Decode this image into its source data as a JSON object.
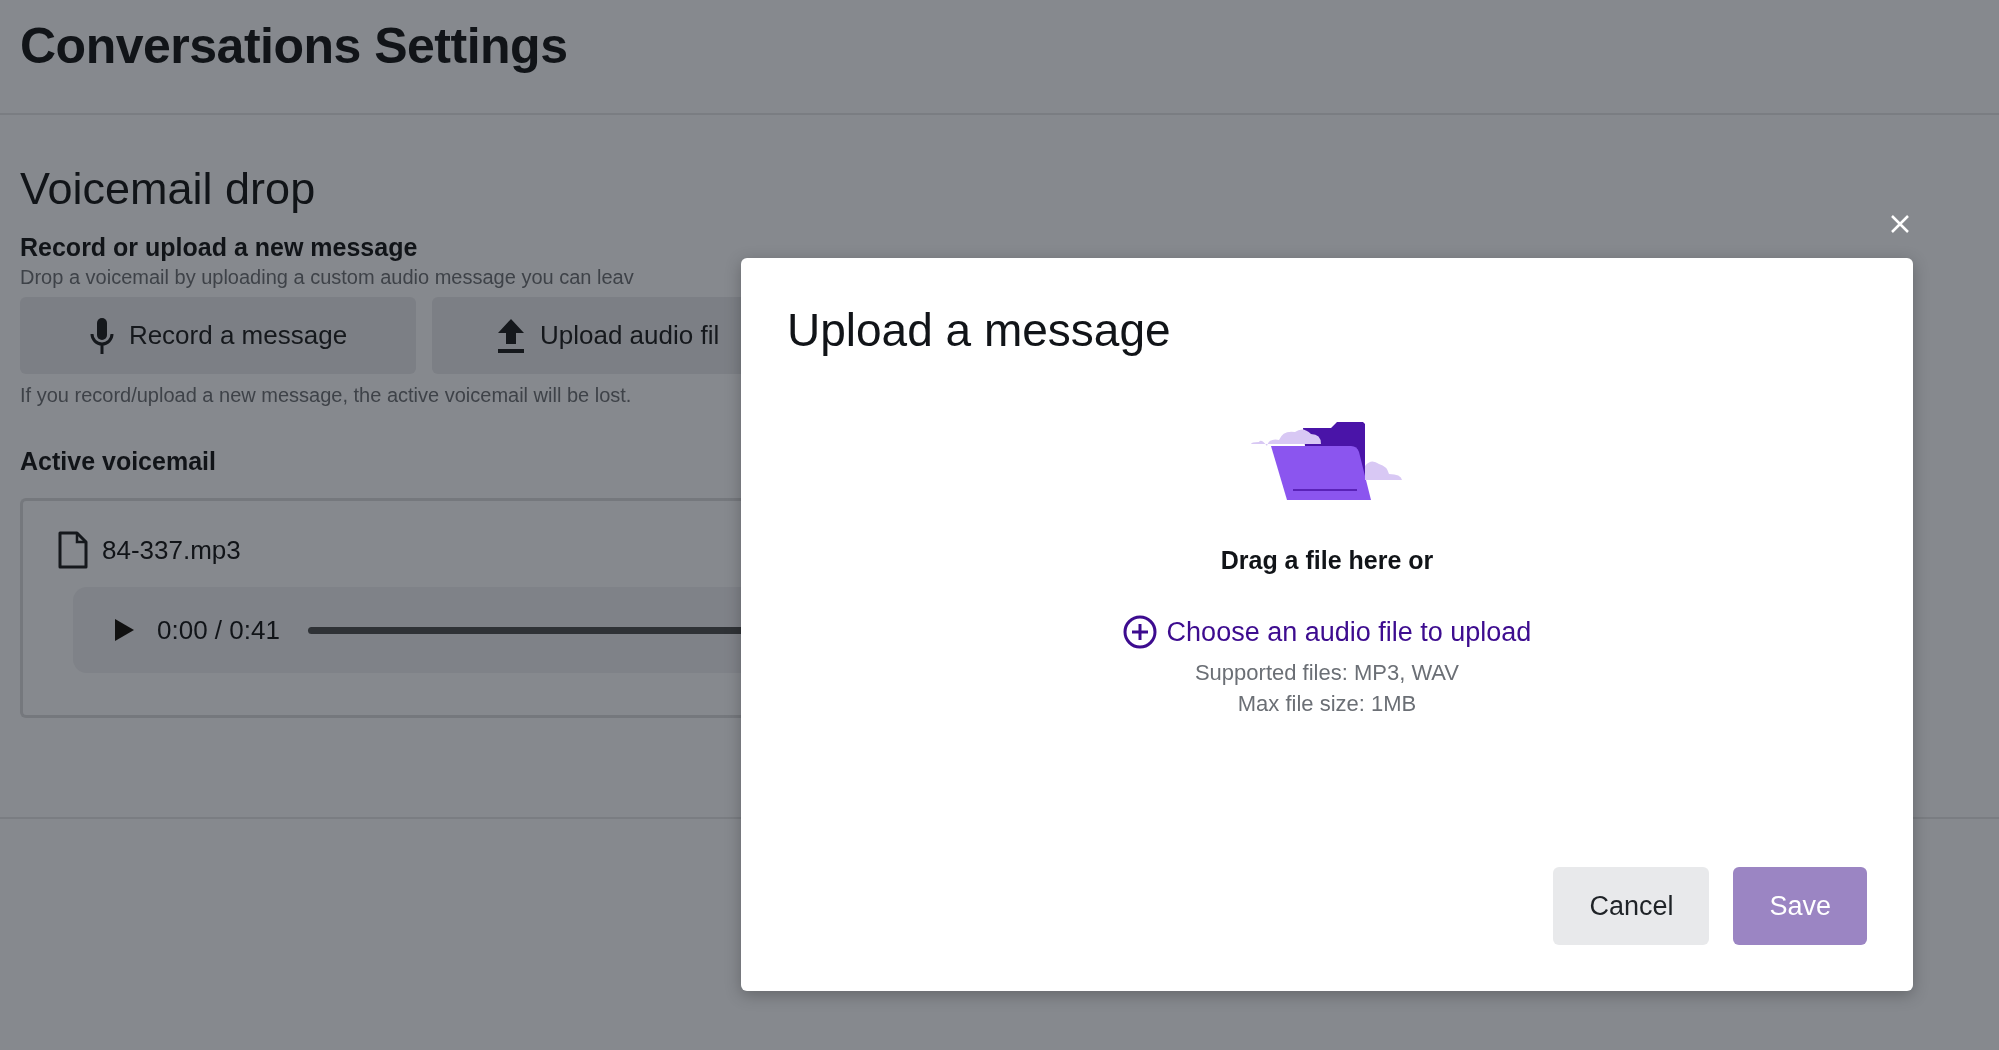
{
  "page": {
    "title": "Conversations Settings"
  },
  "voicemail": {
    "heading": "Voicemail drop",
    "subheading": "Record or upload a new message",
    "description": "Drop a voicemail by uploading a custom audio message you can leav",
    "actions": [
      {
        "kind": "record",
        "label": "Record a message"
      },
      {
        "kind": "upload",
        "label": "Upload audio fil"
      }
    ],
    "warning": "If you record/upload a new message, the active voicemail will be lost.",
    "active_heading": "Active voicemail",
    "file": {
      "name": "84-337.mp3",
      "time": "0:00 / 0:41"
    }
  },
  "dialog": {
    "title": "Upload a message",
    "prompt": "Drag a file here or",
    "link": "Choose an audio file to upload",
    "hints": [
      "Supported files: MP3, WAV",
      "Max file size: 1MB"
    ],
    "buttons": [
      {
        "kind": "secondary",
        "label": "Cancel",
        "disabled": false
      },
      {
        "kind": "primary",
        "label": "Save",
        "disabled": true
      }
    ]
  }
}
